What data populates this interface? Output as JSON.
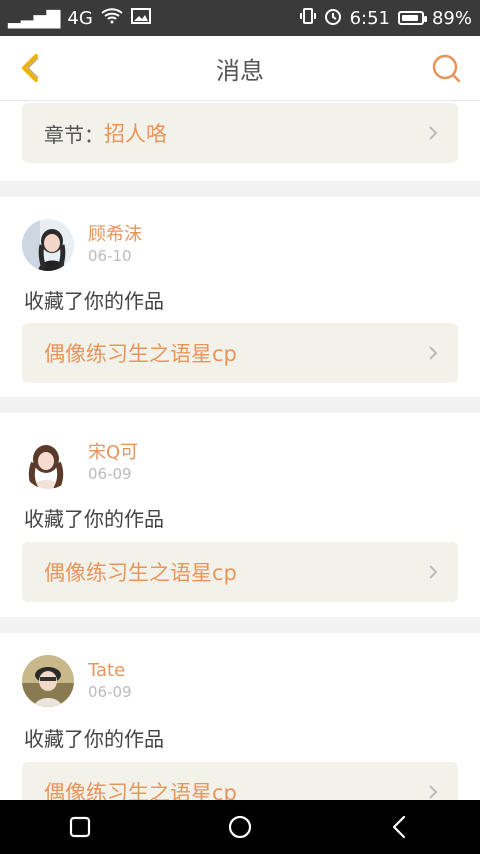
{
  "status_bar": {
    "signal": "᷊ıll",
    "network": "4G",
    "time": "6:51",
    "battery_text": "89%",
    "battery_level": 0.89
  },
  "header": {
    "title": "消息"
  },
  "chapter_row": {
    "prefix": "章节：",
    "title": "招人咯"
  },
  "messages": [
    {
      "user": "顾希沫",
      "date": "06-10",
      "action": "收藏了你的作品",
      "work": "偶像练习生之语星cp"
    },
    {
      "user": "宋Q可",
      "date": "06-09",
      "action": "收藏了你的作品",
      "work": "偶像练习生之语星cp"
    },
    {
      "user": "Tate",
      "date": "06-09",
      "action": "收藏了你的作品",
      "work": "偶像练习生之语星cp"
    }
  ],
  "colors": {
    "accent": "#e8955b",
    "back_icon": "#f0b400",
    "row_bg": "#f3f2ea"
  },
  "icons": {
    "back": "chevron-left-icon",
    "search": "search-icon",
    "row_arrow": "chevron-right-icon",
    "nav_recent": "square-icon",
    "nav_home": "circle-icon",
    "nav_back": "chevron-left-icon"
  }
}
